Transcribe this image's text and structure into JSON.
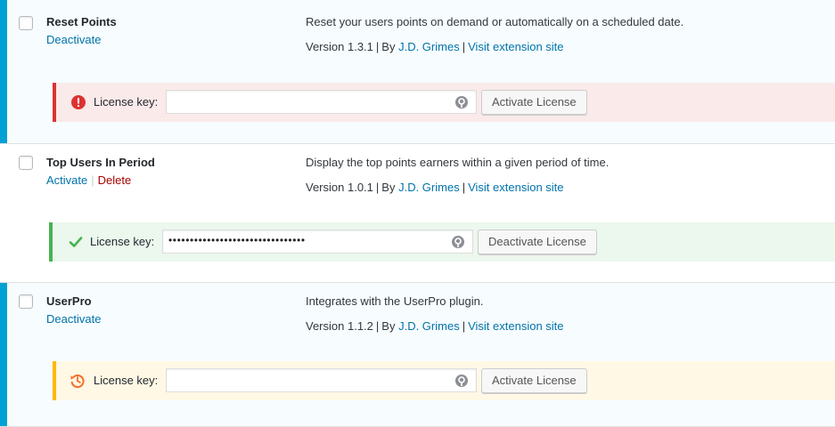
{
  "plugins": [
    {
      "name": "Reset Points",
      "actions": [
        "Deactivate"
      ],
      "description": "Reset your users points on demand or automatically on a scheduled date.",
      "version": "Version 1.3.1",
      "by": "By",
      "author": "J.D. Grimes",
      "visit": "Visit extension site",
      "license": {
        "status": "error",
        "label": "License key:",
        "value": "",
        "button": "Activate License"
      }
    },
    {
      "name": "Top Users In Period",
      "actions": [
        "Activate",
        "Delete"
      ],
      "description": "Display the top points earners within a given period of time.",
      "version": "Version 1.0.1",
      "by": "By",
      "author": "J.D. Grimes",
      "visit": "Visit extension site",
      "license": {
        "status": "success",
        "label": "License key:",
        "value": "••••••••••••••••••••••••••••••••",
        "button": "Deactivate License"
      }
    },
    {
      "name": "UserPro",
      "actions": [
        "Deactivate"
      ],
      "description": "Integrates with the UserPro plugin.",
      "version": "Version 1.1.2",
      "by": "By",
      "author": "J.D. Grimes",
      "visit": "Visit extension site",
      "license": {
        "status": "warning",
        "label": "License key:",
        "value": "",
        "button": "Activate License"
      }
    }
  ],
  "icons": {
    "error": "error-icon",
    "success": "checkmark-icon",
    "warning": "history-clock-icon",
    "key": "key-autofill-icon"
  },
  "colors": {
    "active_bar": "#00a0d2",
    "link": "#0073aa",
    "delete": "#aa0000",
    "error": "#dc3232",
    "success": "#46b450",
    "warning": "#ffb900"
  }
}
